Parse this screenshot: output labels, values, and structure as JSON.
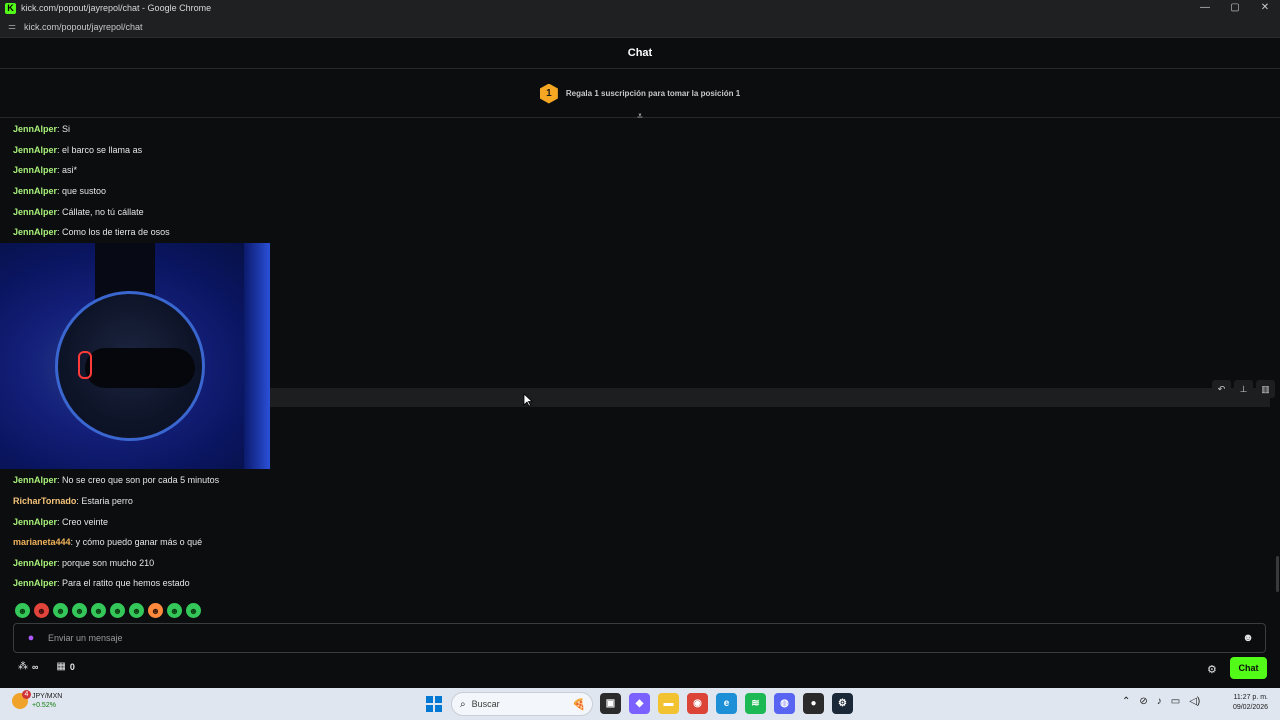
{
  "window": {
    "title": "kick.com/popout/jayrepol/chat - Google Chrome",
    "url": "kick.com/popout/jayrepol/chat",
    "controls": [
      "—",
      "▢",
      "✕"
    ]
  },
  "chat": {
    "header_title": "Chat",
    "promo": {
      "badge_number": "1",
      "text": "Regala 1 suscripción para tomar la posición 1"
    },
    "messages_top": [
      {
        "user": "JennAlper",
        "text": "Si",
        "color": "#a8f07a"
      },
      {
        "user": "JennAlper",
        "text": "el barco se llama as",
        "color": "#a8f07a"
      },
      {
        "user": "JennAlper",
        "text": "asi*",
        "color": "#a8f07a"
      },
      {
        "user": "JennAlper",
        "text": "que sustoo",
        "color": "#a8f07a"
      },
      {
        "user": "JennAlper",
        "text": "Cállate, no tú cállate",
        "color": "#a8f07a"
      },
      {
        "user": "JennAlper",
        "text": "Como los de tierra de osos",
        "color": "#a8f07a"
      }
    ],
    "messages_bottom": [
      {
        "user": "JennAlper",
        "text": "No se creo que son por cada 5 minutos",
        "color": "#a8f07a"
      },
      {
        "user": "RicharTornado",
        "text": "Estaria perro",
        "color": "#f5c37a"
      },
      {
        "user": "JennAlper",
        "text": "Creo veinte",
        "color": "#a8f07a"
      },
      {
        "user": "marianeta444",
        "text": "y cómo puedo ganar más o qué",
        "color": "#f0b35a"
      },
      {
        "user": "JennAlper",
        "text": "porque son mucho 210",
        "color": "#a8f07a"
      },
      {
        "user": "JennAlper",
        "text": "Para el ratito que hemos estado",
        "color": "#a8f07a"
      }
    ],
    "row_actions": [
      "reply-icon",
      "pin-icon",
      "delete-icon"
    ],
    "emotes": [
      "green",
      "red",
      "green",
      "green",
      "green",
      "green",
      "green",
      "orange",
      "green",
      "green"
    ],
    "input": {
      "placeholder": "Enviar un mensaje"
    },
    "bottom": {
      "infinity_label": "∞",
      "gift_count": "0",
      "chat_button": "Chat"
    }
  },
  "taskbar": {
    "weather": {
      "notification_count": "4",
      "ticker": "JPY/MXN",
      "change": "+0.52%"
    },
    "search_placeholder": "Buscar",
    "apps": [
      {
        "name": "task-view",
        "color": "#2b2b2b",
        "glyph": "▣"
      },
      {
        "name": "copilot",
        "color": "#7b61ff",
        "glyph": "◆"
      },
      {
        "name": "file-explorer",
        "color": "#f2c230",
        "glyph": "▬"
      },
      {
        "name": "chrome",
        "color": "#db4437",
        "glyph": "◉"
      },
      {
        "name": "edge",
        "color": "#1d8fd6",
        "glyph": "e"
      },
      {
        "name": "spotify",
        "color": "#1db954",
        "glyph": "≋"
      },
      {
        "name": "discord",
        "color": "#5865f2",
        "glyph": "◍"
      },
      {
        "name": "app-dark",
        "color": "#2b2b2b",
        "glyph": "●"
      },
      {
        "name": "steam",
        "color": "#1b2838",
        "glyph": "⚙"
      }
    ],
    "time": "11:27 p. m.",
    "date": "09/02/2026"
  },
  "colors": {
    "accent": "#53fc18",
    "background": "#0b0d0e"
  }
}
